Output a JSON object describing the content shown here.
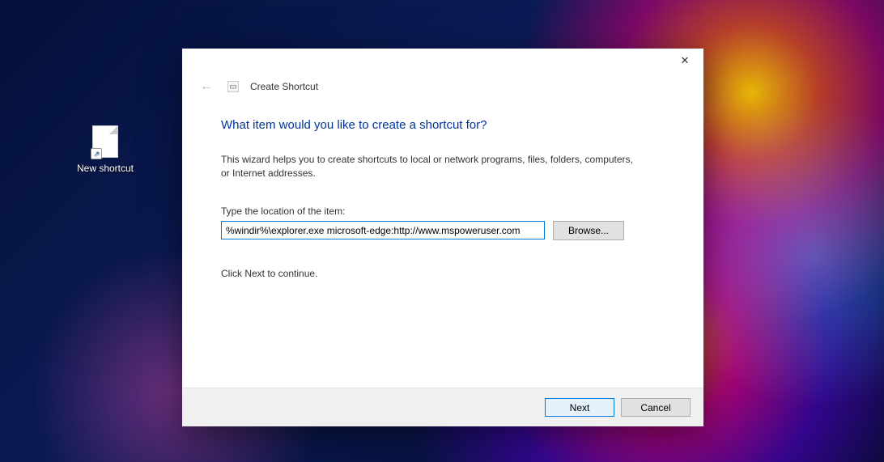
{
  "desktop": {
    "shortcut_label": "New shortcut"
  },
  "dialog": {
    "wizard_title": "Create Shortcut",
    "heading": "What item would you like to create a shortcut for?",
    "description": "This wizard helps you to create shortcuts to local or network programs, files, folders, computers, or Internet addresses.",
    "field_label": "Type the location of the item:",
    "location_value": "%windir%\\explorer.exe microsoft-edge:http://www.mspoweruser.com",
    "browse_label": "Browse...",
    "hint": "Click Next to continue.",
    "next_label": "Next",
    "cancel_label": "Cancel"
  }
}
